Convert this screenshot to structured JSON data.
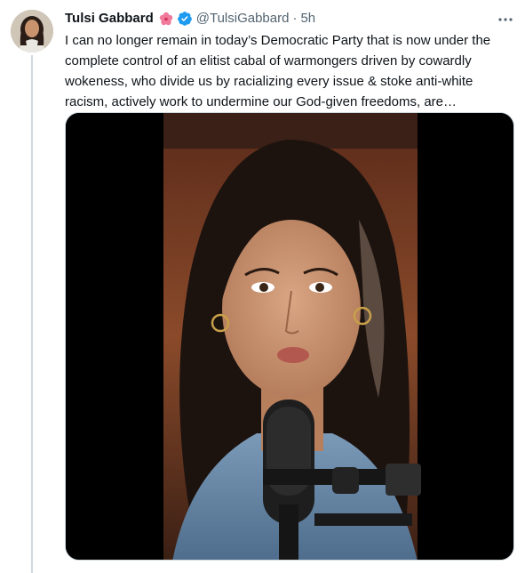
{
  "tweet": {
    "display_name": "Tulsi Gabbard",
    "handle": "@TulsiGabbard",
    "separator": "·",
    "time": "5h",
    "text": "I can no longer remain in today’s Democratic Party that is now under the complete control of an elitist cabal of warmongers driven by cowardly wokeness, who divide us by racializing every issue & stoke anti-white racism, actively work to undermine our God-given freedoms, are…",
    "icons": {
      "avatar": "avatar-photo",
      "name_emoji": "hibiscus-flower-icon",
      "verified": "verified-badge-icon",
      "more": "more-options-icon"
    },
    "media": {
      "type": "video",
      "icon": "video-still-image"
    }
  },
  "colors": {
    "text": "#0f1419",
    "secondary": "#536471",
    "verified_blue": "#1d9bf0",
    "border": "#cfd9de"
  }
}
